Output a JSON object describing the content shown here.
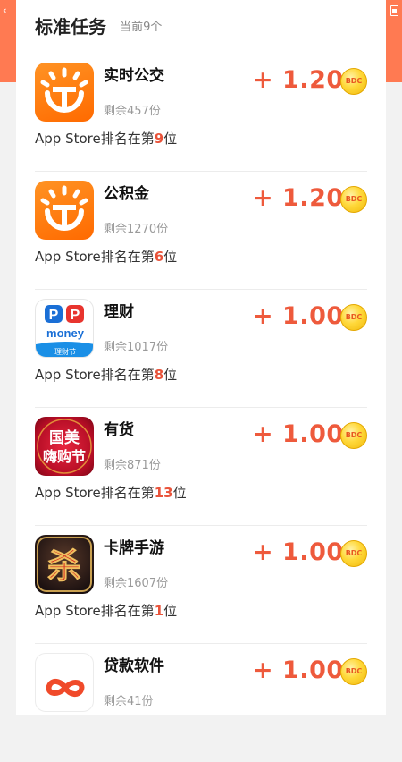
{
  "header": {
    "title": "标准任务",
    "count": "当前9个"
  },
  "coin_label": "BDC",
  "tasks": [
    {
      "name": "实时公交",
      "remaining": "剩余457份",
      "rank_prefix": "App Store排名在第",
      "rank": "9",
      "rank_suffix": "位",
      "reward": "+ 1.20",
      "icon": "bus-app-icon"
    },
    {
      "name": "公积金",
      "remaining": "剩余1270份",
      "rank_prefix": "App Store排名在第",
      "rank": "6",
      "rank_suffix": "位",
      "reward": "+ 1.20",
      "icon": "fund-app-icon"
    },
    {
      "name": "理财",
      "remaining": "剩余1017份",
      "rank_prefix": "App Store排名在第",
      "rank": "8",
      "rank_suffix": "位",
      "reward": "+ 1.00",
      "icon": "pp-money-app-icon",
      "icon_text": {
        "top": "PP",
        "mid": "money",
        "bottom": "理财节"
      }
    },
    {
      "name": "有货",
      "remaining": "剩余871份",
      "rank_prefix": "App Store排名在第",
      "rank": "13",
      "rank_suffix": "位",
      "reward": "+ 1.00",
      "icon": "gome-shopping-festival-app-icon",
      "icon_text": {
        "line1": "国美",
        "line2": "嗨购节"
      }
    },
    {
      "name": "卡牌手游",
      "remaining": "剩余1607份",
      "rank_prefix": "App Store排名在第",
      "rank": "1",
      "rank_suffix": "位",
      "reward": "+ 1.00",
      "icon": "card-game-app-icon",
      "icon_text": {
        "glyph": "杀"
      }
    },
    {
      "name": "贷款软件",
      "remaining": "剩余41份",
      "reward": "+ 1.00",
      "icon": "infinity-loan-app-icon"
    }
  ],
  "colors": {
    "accent": "#ee5a3c",
    "edge": "#ff7a52",
    "coin": "#ffd83a"
  }
}
